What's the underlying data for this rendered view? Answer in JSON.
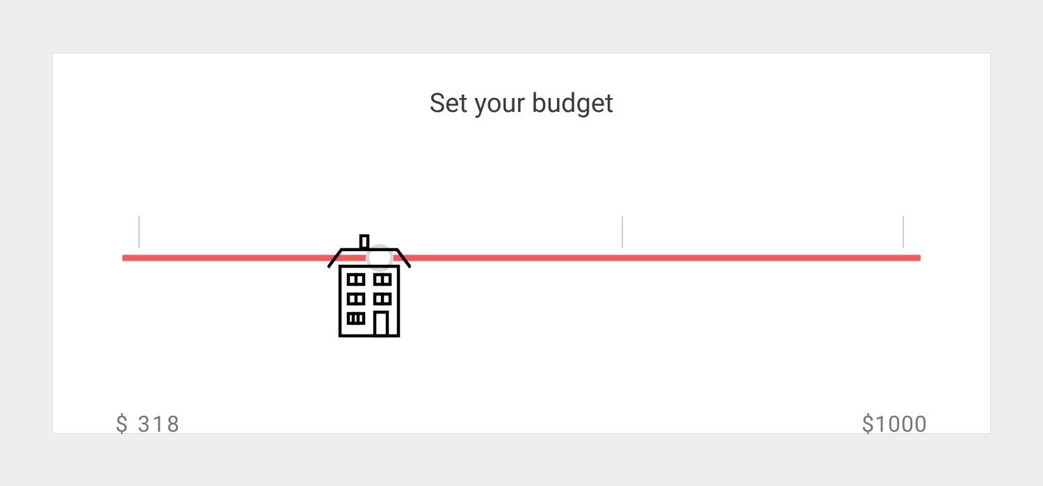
{
  "title": "Set your budget",
  "slider": {
    "min_label": "$ 318",
    "max_label": "$1000",
    "handle_position_percent": 32.2,
    "icon_name": "house-building-icon"
  }
}
